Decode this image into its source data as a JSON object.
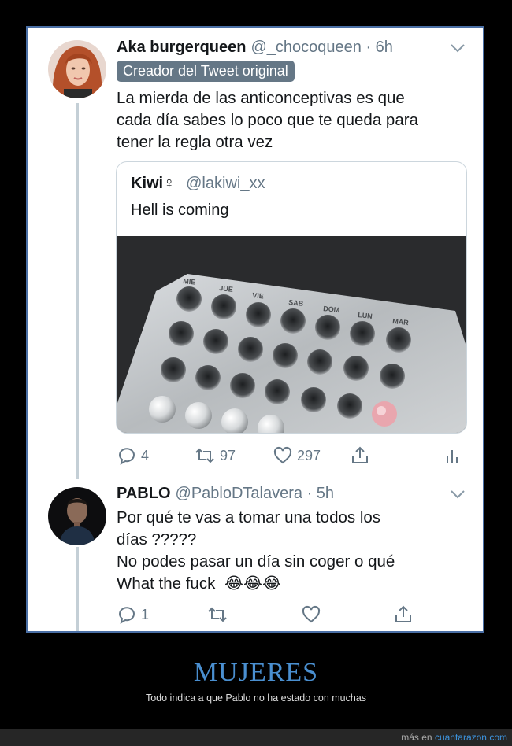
{
  "tweet1": {
    "name": "Aka burgerqueen",
    "handle": "@_chocoqueen · 6h",
    "badge": "Creador del Tweet original",
    "lines": [
      "La mierda de las anticonceptivas es que",
      "cada día sabes lo poco que te queda para",
      "tener la regla otra vez"
    ],
    "quote": {
      "name": "Kiwi♀",
      "handle": "@lakiwi_xx",
      "text": "Hell is coming",
      "pill_days": [
        "MIE",
        "JUE",
        "VIE",
        "SAB",
        "DOM",
        "LUN",
        "MAR"
      ]
    },
    "replies": "4",
    "retweets": "97",
    "likes": "297"
  },
  "tweet2": {
    "name": "PABLO",
    "handle": "@PabloDTalavera · 5h",
    "lines": [
      "Por qué te vas a tomar una todos los",
      "días ?????",
      "No podes pasar un día sin coger o qué",
      "What the fuck"
    ],
    "emoji": "😂😂😂",
    "replies": "1",
    "retweets": "",
    "likes": ""
  },
  "footer": {
    "title": "MUJERES",
    "subtitle": "Todo indica a que Pablo no ha estado con muchas",
    "credit_prefix": "más en",
    "credit_site": "cuantarazon.com"
  },
  "icons": [
    "chevron-down-icon",
    "reply-icon",
    "retweet-icon",
    "like-icon",
    "share-icon",
    "analytics-icon",
    "laughing-emoji"
  ],
  "colors": {
    "accent": "#4a8fd0",
    "text_secondary": "#657786",
    "frame_border": "#4a6fa5"
  }
}
